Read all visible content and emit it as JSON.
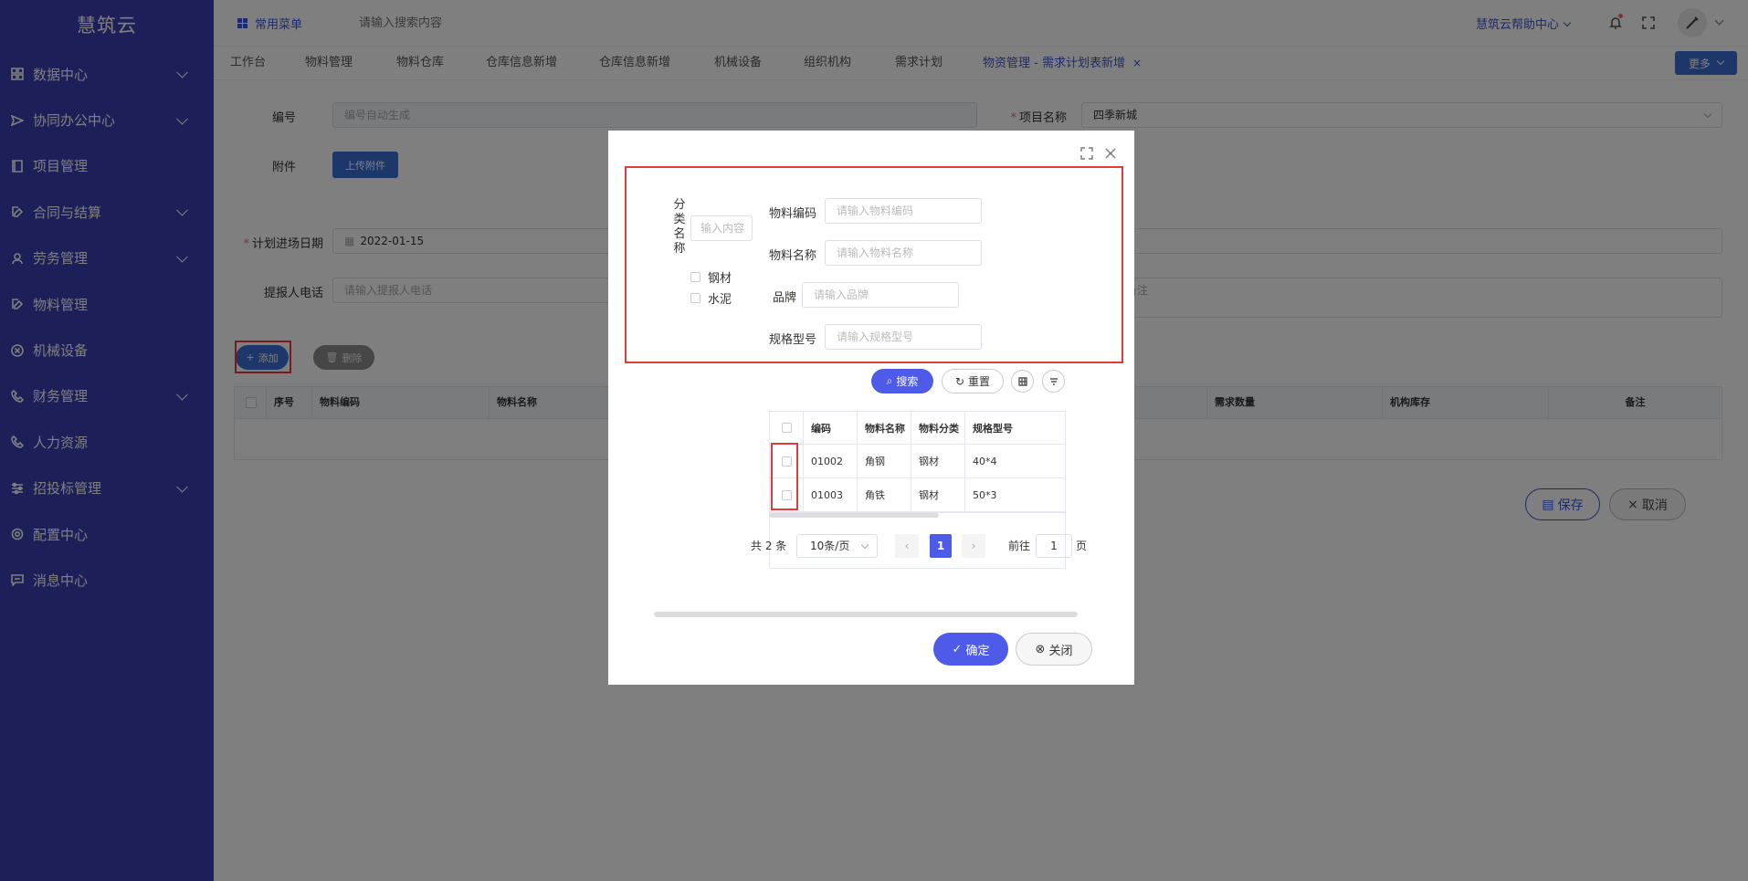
{
  "sidebar": {
    "logo": "慧筑云",
    "items": [
      {
        "label": "数据中心",
        "icon": "grid-icon",
        "expandable": true
      },
      {
        "label": "协同办公中心",
        "icon": "send-icon",
        "expandable": true
      },
      {
        "label": "项目管理",
        "icon": "book-icon",
        "expandable": false
      },
      {
        "label": "合同与结算",
        "icon": "edit-icon",
        "expandable": true
      },
      {
        "label": "劳务管理",
        "icon": "user-icon",
        "expandable": true
      },
      {
        "label": "物料管理",
        "icon": "edit-icon",
        "expandable": false
      },
      {
        "label": "机械设备",
        "icon": "circle-x-icon",
        "expandable": false
      },
      {
        "label": "财务管理",
        "icon": "phone-icon",
        "expandable": true
      },
      {
        "label": "人力资源",
        "icon": "phone-icon",
        "expandable": false
      },
      {
        "label": "招投标管理",
        "icon": "sliders-icon",
        "expandable": true
      },
      {
        "label": "配置中心",
        "icon": "gear-icon",
        "expandable": false
      },
      {
        "label": "消息中心",
        "icon": "message-icon",
        "expandable": false
      }
    ]
  },
  "header": {
    "fav_menu": "常用菜单",
    "search_placeholder": "请输入搜索内容",
    "help": "慧筑云帮助中心"
  },
  "tabs": {
    "items": [
      "工作台",
      "物料管理",
      "物料仓库",
      "仓库信息新增",
      "仓库信息新增",
      "机械设备",
      "组织机构",
      "需求计划",
      "物资管理 - 需求计划表新增"
    ],
    "close": "×",
    "more": "更多"
  },
  "form": {
    "code_label": "编号",
    "code_placeholder": "编号自动生成",
    "project_label": "项目名称",
    "project_value": "四季新城",
    "attachment_label": "附件",
    "upload_btn": "上传附件",
    "date_label": "计划进场日期",
    "date_value": "2022-01-15",
    "phone_label": "提报人电话",
    "phone_placeholder": "请输入提报人电话",
    "remark_placeholder": "请输入备注",
    "add_btn": "添加",
    "delete_btn": "删除",
    "grid_headers": [
      "序号",
      "物料编码",
      "物料名称",
      "需求数量",
      "机构库存",
      "备注"
    ],
    "save_btn": "保存",
    "cancel_btn": "取消"
  },
  "dialog": {
    "category_label": "分类名称",
    "category_placeholder": "输入内容",
    "categories": [
      "钢材",
      "水泥"
    ],
    "filters": [
      {
        "label": "物料编码",
        "placeholder": "请输入物料编码"
      },
      {
        "label": "物料名称",
        "placeholder": "请输入物料名称"
      },
      {
        "label": "品牌",
        "placeholder": "请输入品牌"
      },
      {
        "label": "规格型号",
        "placeholder": "请输入规格型号"
      }
    ],
    "search_btn": "搜索",
    "reset_btn": "重置",
    "table": {
      "headers": [
        "编码",
        "物料名称",
        "物料分类",
        "规格型号"
      ],
      "rows": [
        [
          "01002",
          "角钢",
          "钢材",
          "40*4"
        ],
        [
          "01003",
          "角铁",
          "钢材",
          "50*3"
        ]
      ]
    },
    "pager": {
      "total": "共 2 条",
      "size": "10条/页",
      "current": "1",
      "goto_label": "前往",
      "goto_value": "1",
      "page_suffix": "页"
    },
    "ok_btn": "确定",
    "close_btn": "关闭"
  }
}
